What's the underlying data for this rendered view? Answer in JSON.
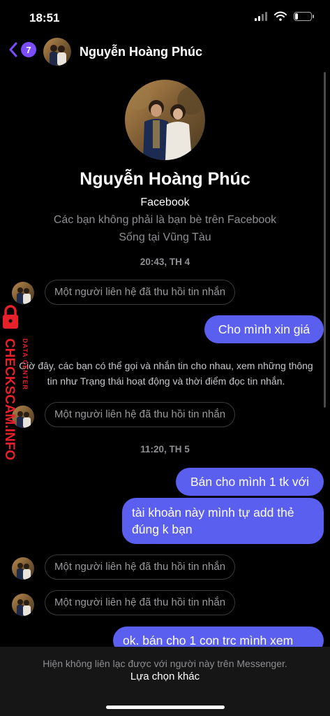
{
  "status_bar": {
    "time": "18:51",
    "battery_level": 0.2
  },
  "header": {
    "back_badge": "7",
    "contact_name": "Nguyễn Hoàng Phúc"
  },
  "profile": {
    "name": "Nguyễn Hoàng Phúc",
    "source": "Facebook",
    "friend_status": "Các bạn không phải là bạn bè trên Facebook",
    "location": "Sống tại Vũng Tàu"
  },
  "conversation": {
    "timestamp_1": "20:43, TH 4",
    "recalled_1": "Một người liên hệ đã thu hồi tin nhắn",
    "out_1": "Cho mình xin giá",
    "info": "Giờ đây, các bạn có thể gọi và nhắn tin cho nhau, xem những thông tin như Trạng thái hoạt động và thời điểm đọc tin nhắn.",
    "recalled_2": "Một người liên hệ đã thu hồi tin nhắn",
    "timestamp_2": "11:20, TH 5",
    "out_2": "Bán cho mình 1 tk với",
    "out_3_line1": "tài khoản này mình tự add thẻ",
    "out_3_line2": "đúng k bạn",
    "recalled_3": "Một người liên hệ đã thu hồi tin nhắn",
    "recalled_4": "Một người liên hệ đã thu hồi tin nhắn",
    "out_4": "ok. bán cho 1 con trc mình xem"
  },
  "footer": {
    "note": "Hiện không liên lạc được với người này trên Messenger.",
    "action": "Lựa chọn khác"
  },
  "watermark": {
    "brand": "CHECKSCAM.INFO",
    "tagline": "DATA CENTER"
  },
  "colors": {
    "accent": "#7b4dff",
    "bubble": "#5b5ff0",
    "watermark": "#e8202a"
  }
}
